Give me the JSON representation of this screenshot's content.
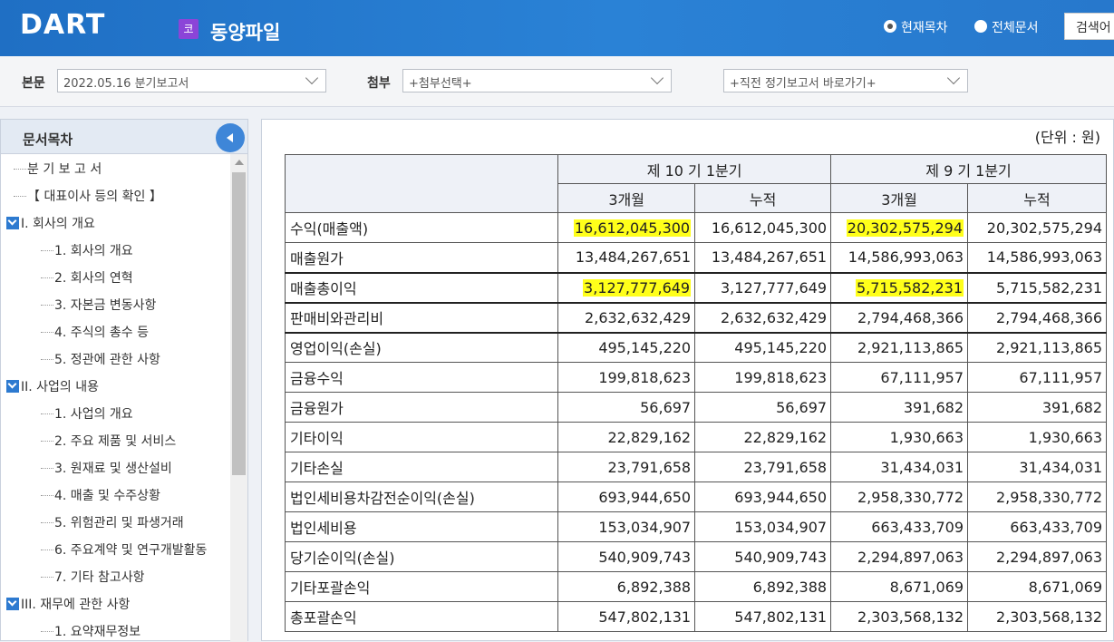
{
  "header": {
    "logo": "DART",
    "company_badge": "코",
    "company_name": "동양파일",
    "radio_current": "현재목차",
    "radio_all": "전체문서",
    "search_label": "검색어"
  },
  "toolbar": {
    "main_label": "본문",
    "main_value": "2022.05.16  분기보고서",
    "attach_label": "첨부",
    "attach_value": "+첨부선택+",
    "goto_value": "+직전 정기보고서 바로가기+"
  },
  "sidebar": {
    "title": "문서목차",
    "items": [
      {
        "label": "분 기 보 고 서",
        "level": 0
      },
      {
        "label": "【 대표이사 등의 확인 】",
        "level": 0
      },
      {
        "label": "I. 회사의 개요",
        "level": 0,
        "toggle": true
      },
      {
        "label": "1. 회사의 개요",
        "level": 1
      },
      {
        "label": "2. 회사의 연혁",
        "level": 1
      },
      {
        "label": "3. 자본금 변동사항",
        "level": 1
      },
      {
        "label": "4. 주식의 총수 등",
        "level": 1
      },
      {
        "label": "5. 정관에 관한 사항",
        "level": 1
      },
      {
        "label": "II. 사업의 내용",
        "level": 0,
        "toggle": true
      },
      {
        "label": "1. 사업의 개요",
        "level": 1
      },
      {
        "label": "2. 주요 제품 및 서비스",
        "level": 1
      },
      {
        "label": "3. 원재료 및 생산설비",
        "level": 1
      },
      {
        "label": "4. 매출 및 수주상황",
        "level": 1
      },
      {
        "label": "5. 위험관리 및 파생거래",
        "level": 1
      },
      {
        "label": "6. 주요계약 및 연구개발활동",
        "level": 1
      },
      {
        "label": "7. 기타 참고사항",
        "level": 1
      },
      {
        "label": "III. 재무에 관한 사항",
        "level": 0,
        "toggle": true
      },
      {
        "label": "1. 요약재무정보",
        "level": 1
      }
    ]
  },
  "content": {
    "unit": "(단위 : 원)",
    "period1": "제 10 기 1분기",
    "period2": "제 9 기 1분기",
    "sub_3m": "3개월",
    "sub_cum": "누적",
    "rows": [
      {
        "label": "수익(매출액)",
        "v": [
          "16,612,045,300",
          "16,612,045,300",
          "20,302,575,294",
          "20,302,575,294"
        ],
        "hl": [
          true,
          false,
          true,
          false
        ]
      },
      {
        "label": "매출원가",
        "v": [
          "13,484,267,651",
          "13,484,267,651",
          "14,586,993,063",
          "14,586,993,063"
        ],
        "hl": [
          false,
          false,
          false,
          false
        ]
      },
      {
        "label": "매출총이익",
        "v": [
          "3,127,777,649",
          "3,127,777,649",
          "5,715,582,231",
          "5,715,582,231"
        ],
        "hl": [
          true,
          false,
          true,
          false
        ],
        "thick": true
      },
      {
        "label": "판매비와관리비",
        "v": [
          "2,632,632,429",
          "2,632,632,429",
          "2,794,468,366",
          "2,794,468,366"
        ],
        "hl": [
          false,
          false,
          false,
          false
        ],
        "thick": true
      },
      {
        "label": "영업이익(손실)",
        "v": [
          "495,145,220",
          "495,145,220",
          "2,921,113,865",
          "2,921,113,865"
        ],
        "hl": [
          false,
          false,
          false,
          false
        ],
        "thick": true
      },
      {
        "label": "금융수익",
        "v": [
          "199,818,623",
          "199,818,623",
          "67,111,957",
          "67,111,957"
        ],
        "hl": [
          false,
          false,
          false,
          false
        ]
      },
      {
        "label": "금융원가",
        "v": [
          "56,697",
          "56,697",
          "391,682",
          "391,682"
        ],
        "hl": [
          false,
          false,
          false,
          false
        ]
      },
      {
        "label": "기타이익",
        "v": [
          "22,829,162",
          "22,829,162",
          "1,930,663",
          "1,930,663"
        ],
        "hl": [
          false,
          false,
          false,
          false
        ]
      },
      {
        "label": "기타손실",
        "v": [
          "23,791,658",
          "23,791,658",
          "31,434,031",
          "31,434,031"
        ],
        "hl": [
          false,
          false,
          false,
          false
        ]
      },
      {
        "label": "법인세비용차감전순이익(손실)",
        "v": [
          "693,944,650",
          "693,944,650",
          "2,958,330,772",
          "2,958,330,772"
        ],
        "hl": [
          false,
          false,
          false,
          false
        ]
      },
      {
        "label": "법인세비용",
        "v": [
          "153,034,907",
          "153,034,907",
          "663,433,709",
          "663,433,709"
        ],
        "hl": [
          false,
          false,
          false,
          false
        ]
      },
      {
        "label": "당기순이익(손실)",
        "v": [
          "540,909,743",
          "540,909,743",
          "2,294,897,063",
          "2,294,897,063"
        ],
        "hl": [
          false,
          false,
          false,
          false
        ]
      },
      {
        "label": "기타포괄손익",
        "v": [
          "6,892,388",
          "6,892,388",
          "8,671,069",
          "8,671,069"
        ],
        "hl": [
          false,
          false,
          false,
          false
        ]
      },
      {
        "label": "총포괄손익",
        "v": [
          "547,802,131",
          "547,802,131",
          "2,303,568,132",
          "2,303,568,132"
        ],
        "hl": [
          false,
          false,
          false,
          false
        ]
      }
    ]
  }
}
